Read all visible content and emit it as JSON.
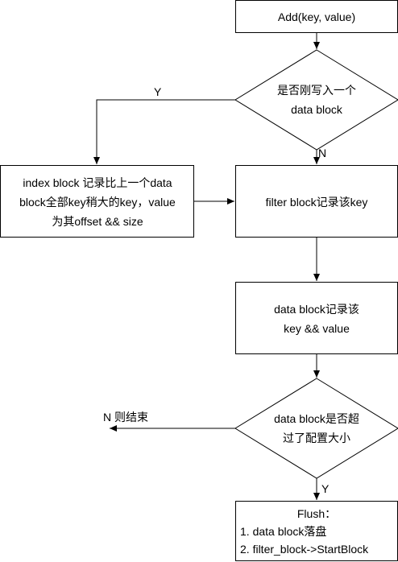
{
  "nodes": {
    "add": {
      "text": "Add(key, value)"
    },
    "decision_written": {
      "line1": "是否刚写入一个",
      "line2": "data block"
    },
    "index_block": {
      "line1": "index block 记录比上一个data",
      "line2": "block全部key稍大的key，value",
      "line3": "为其offset && size"
    },
    "filter_block": {
      "text": "filter block记录该key"
    },
    "data_block": {
      "line1": "data block记录该",
      "line2": "key && value"
    },
    "decision_size": {
      "line1": "data block是否超",
      "line2": "过了配置大小"
    },
    "flush": {
      "line1": "Flush：",
      "line2": "1. data block落盘",
      "line3": "2. filter_block->StartBlock"
    }
  },
  "edges": {
    "yes_left": "Y",
    "no_down": "N",
    "no_end": "N 则结束",
    "yes_down": "Y"
  }
}
